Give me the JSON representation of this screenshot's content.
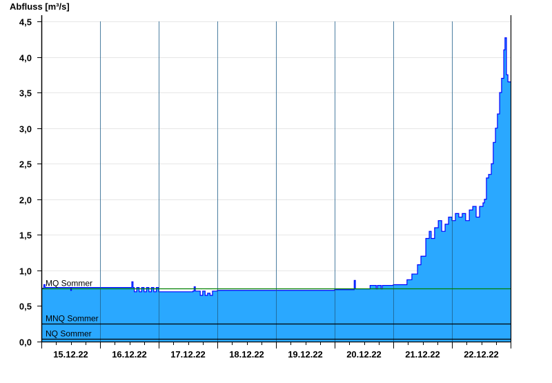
{
  "chart_data": {
    "type": "area",
    "ylabel": "Abfluss [m³/s]",
    "ylim": [
      0,
      4.5
    ],
    "yticks": [
      0,
      0.5,
      1.0,
      1.5,
      2.0,
      2.5,
      3.0,
      3.5,
      4.0,
      4.5
    ],
    "ytick_labels": [
      "0,0",
      "0,5",
      "1,0",
      "1,5",
      "2,0",
      "2,5",
      "3,0",
      "3,5",
      "4,0",
      "4,5"
    ],
    "x_unit": "hours since 15.12.22 00:00",
    "xlim": [
      0,
      192
    ],
    "xtick_labels": [
      "15.12.22",
      "16.12.22",
      "17.12.22",
      "18.12.22",
      "19.12.22",
      "20.12.22",
      "21.12.22",
      "22.12.22"
    ],
    "grid": true,
    "colors": {
      "fill": "#2aa8ff",
      "line": "#0000ff",
      "mq": "#008000",
      "ref": "#000000",
      "grid": "#e6e6e6"
    },
    "reference_lines": [
      {
        "label": "MQ Sommer",
        "value": 0.75
      },
      {
        "label": "MNQ Sommer",
        "value": 0.25
      },
      {
        "label": "NQ Sommer",
        "value": 0.04
      }
    ],
    "series": [
      {
        "name": "Abfluss",
        "x": [
          0,
          1,
          1.5,
          3,
          12,
          12.3,
          14,
          36.5,
          37,
          37.5,
          38,
          39,
          40,
          41,
          42,
          43,
          44,
          45,
          46,
          47,
          48,
          54,
          62,
          62.5,
          63,
          64,
          65,
          66,
          67,
          68,
          69,
          70,
          72,
          96,
          120,
          127.5,
          128,
          128.5,
          134,
          134.5,
          137,
          137.5,
          139,
          139.5,
          140,
          144,
          147,
          149.6,
          151.6,
          153.9,
          155.3,
          157.3,
          158.7,
          159.5,
          160.9,
          162.4,
          163.8,
          165.2,
          166.6,
          168,
          169.4,
          170.8,
          172.2,
          173.6,
          175.1,
          176.5,
          177.9,
          179.3,
          180.7,
          181.3,
          182.1,
          183,
          184.1,
          184.9,
          185.8,
          186.6,
          187.5,
          188.3,
          189.2,
          189.7,
          190.3,
          190.9,
          192
        ],
        "values": [
          0.75,
          0.8,
          0.76,
          0.76,
          0.72,
          0.76,
          0.76,
          0.76,
          0.84,
          0.76,
          0.7,
          0.76,
          0.7,
          0.76,
          0.7,
          0.76,
          0.7,
          0.76,
          0.7,
          0.76,
          0.7,
          0.7,
          0.71,
          0.77,
          0.71,
          0.71,
          0.65,
          0.71,
          0.65,
          0.68,
          0.65,
          0.71,
          0.72,
          0.72,
          0.73,
          0.73,
          0.86,
          0.74,
          0.74,
          0.79,
          0.74,
          0.79,
          0.74,
          0.79,
          0.79,
          0.8,
          0.8,
          0.87,
          0.95,
          1.08,
          1.2,
          1.45,
          1.55,
          1.45,
          1.6,
          1.7,
          1.55,
          1.65,
          1.75,
          1.7,
          1.8,
          1.75,
          1.8,
          1.7,
          1.85,
          1.9,
          1.75,
          1.9,
          1.95,
          2.0,
          2.3,
          2.35,
          2.5,
          2.8,
          3.0,
          3.2,
          3.5,
          3.7,
          4.1,
          4.27,
          3.75,
          3.65,
          3.65
        ]
      }
    ]
  }
}
